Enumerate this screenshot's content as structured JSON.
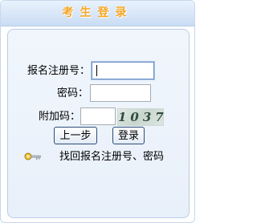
{
  "header": {
    "title": "考生登录"
  },
  "form": {
    "reg_label": "报名注册号：",
    "pwd_label": "密码：",
    "code_label": "附加码：",
    "reg_value": "",
    "pwd_value": "",
    "code_value": "",
    "captcha_text": "1037"
  },
  "buttons": {
    "prev": "上一步",
    "login": "登录"
  },
  "recover_link": "找回报名注册号、密码",
  "colors": {
    "title": "#f5a623",
    "panel_border": "#b9cde7",
    "header_bg": "#c9dcf4"
  }
}
